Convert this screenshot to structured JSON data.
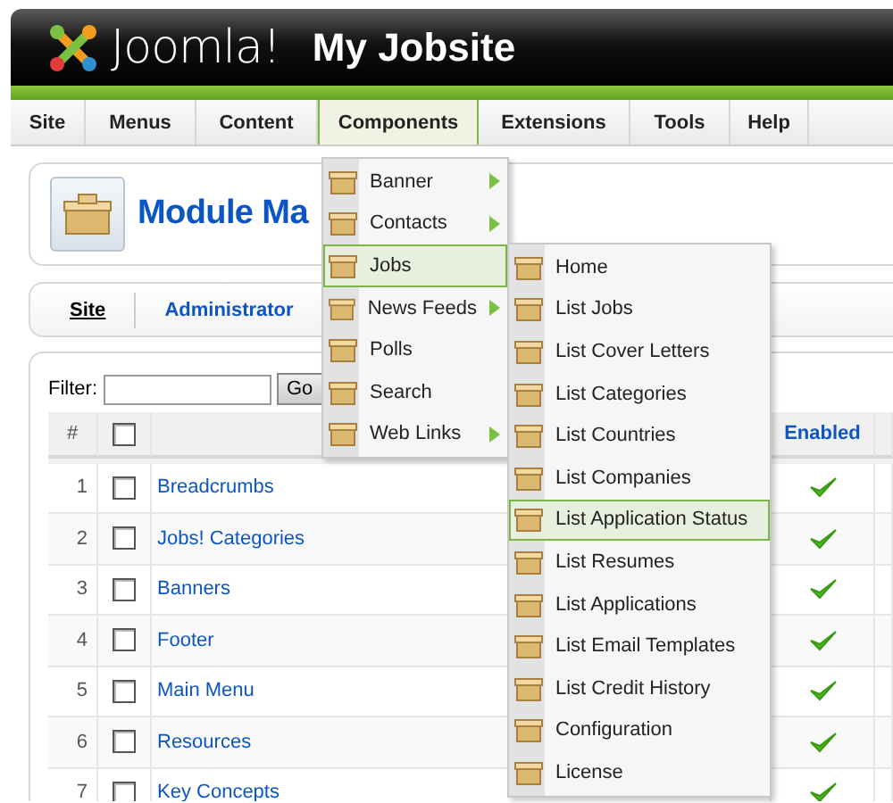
{
  "header": {
    "logo": "Joomla!",
    "site_title": "My Jobsite"
  },
  "menu_bar": [
    {
      "label": "Site",
      "selected": false
    },
    {
      "label": "Menus",
      "selected": false
    },
    {
      "label": "Content",
      "selected": false
    },
    {
      "label": "Components",
      "selected": true
    },
    {
      "label": "Extensions",
      "selected": false
    },
    {
      "label": "Tools",
      "selected": false
    },
    {
      "label": "Help",
      "selected": false
    }
  ],
  "components_menu": [
    {
      "label": "Banner",
      "has_submenu": true,
      "selected": false
    },
    {
      "label": "Contacts",
      "has_submenu": true,
      "selected": false
    },
    {
      "label": "Jobs",
      "has_submenu": false,
      "selected": true
    },
    {
      "label": "News Feeds",
      "has_submenu": true,
      "selected": false
    },
    {
      "label": "Polls",
      "has_submenu": false,
      "selected": false
    },
    {
      "label": "Search",
      "has_submenu": false,
      "selected": false
    },
    {
      "label": "Web Links",
      "has_submenu": true,
      "selected": false
    }
  ],
  "jobs_submenu": [
    {
      "label": "Home",
      "selected": false
    },
    {
      "label": "List Jobs",
      "selected": false
    },
    {
      "label": "List Cover Letters",
      "selected": false
    },
    {
      "label": "List Categories",
      "selected": false
    },
    {
      "label": "List Countries",
      "selected": false
    },
    {
      "label": "List Companies",
      "selected": false
    },
    {
      "label": "List Application Status",
      "selected": true
    },
    {
      "label": "List Resumes",
      "selected": false
    },
    {
      "label": "List Applications",
      "selected": false
    },
    {
      "label": "List Email Templates",
      "selected": false
    },
    {
      "label": "List Credit History",
      "selected": false
    },
    {
      "label": "Configuration",
      "selected": false
    },
    {
      "label": "License",
      "selected": false
    }
  ],
  "page_title": "Module Ma",
  "sub_tabs": [
    {
      "label": "Site",
      "selected": true
    },
    {
      "label": "Administrator",
      "selected": false
    }
  ],
  "filter": {
    "label": "Filter:",
    "button": "Go"
  },
  "table": {
    "number_column": "#",
    "select_all_checked": false,
    "enabled_column": "Enabled",
    "rows": [
      {
        "number": "1",
        "title": "Breadcrumbs",
        "checked": false,
        "enabled": true
      },
      {
        "number": "2",
        "title": "Jobs! Categories",
        "checked": false,
        "enabled": true
      },
      {
        "number": "3",
        "title": "Banners",
        "checked": false,
        "enabled": true
      },
      {
        "number": "4",
        "title": "Footer",
        "checked": false,
        "enabled": true
      },
      {
        "number": "5",
        "title": "Main Menu",
        "checked": false,
        "enabled": true
      },
      {
        "number": "6",
        "title": "Resources",
        "checked": false,
        "enabled": true
      },
      {
        "number": "7",
        "title": "Key Concepts",
        "checked": false,
        "enabled": true
      }
    ]
  }
}
